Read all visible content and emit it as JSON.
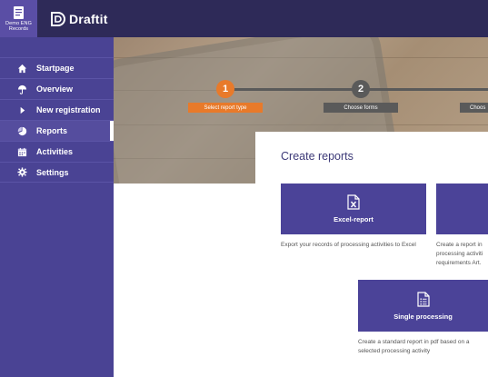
{
  "header": {
    "org_name": "Demo ENG Records",
    "logo_text": "Draftit"
  },
  "sidebar": {
    "items": [
      {
        "label": "Startpage",
        "icon": "home-icon"
      },
      {
        "label": "Overview",
        "icon": "umbrella-icon"
      },
      {
        "label": "New registration",
        "icon": "play-icon"
      },
      {
        "label": "Reports",
        "icon": "pie-chart-icon",
        "active": true
      },
      {
        "label": "Activities",
        "icon": "calendar-icon"
      },
      {
        "label": "Settings",
        "icon": "gear-icon"
      }
    ]
  },
  "wizard": {
    "steps": [
      {
        "number": "1",
        "label": "Select report type",
        "state": "active"
      },
      {
        "number": "2",
        "label": "Choose forms",
        "state": "inactive"
      },
      {
        "number": "",
        "label": "Choos",
        "state": "inactive"
      }
    ]
  },
  "main": {
    "title": "Create reports",
    "cards": [
      {
        "label": "Excel-report",
        "icon": "excel-file-icon",
        "description": "Export your records of processing activities to Excel"
      },
      {
        "label": "",
        "icon": "",
        "description_lines": [
          "Create a report in",
          "processing activiti",
          "requirements Art."
        ]
      },
      {
        "label": "Single processing",
        "icon": "document-list-icon",
        "description": "Create a standard report in pdf based on a selected processing activity"
      }
    ]
  },
  "colors": {
    "topbar": "#2e2a58",
    "sidebar": "#4a4394",
    "accent_orange": "#e87a2a",
    "card": "#4b4398"
  }
}
